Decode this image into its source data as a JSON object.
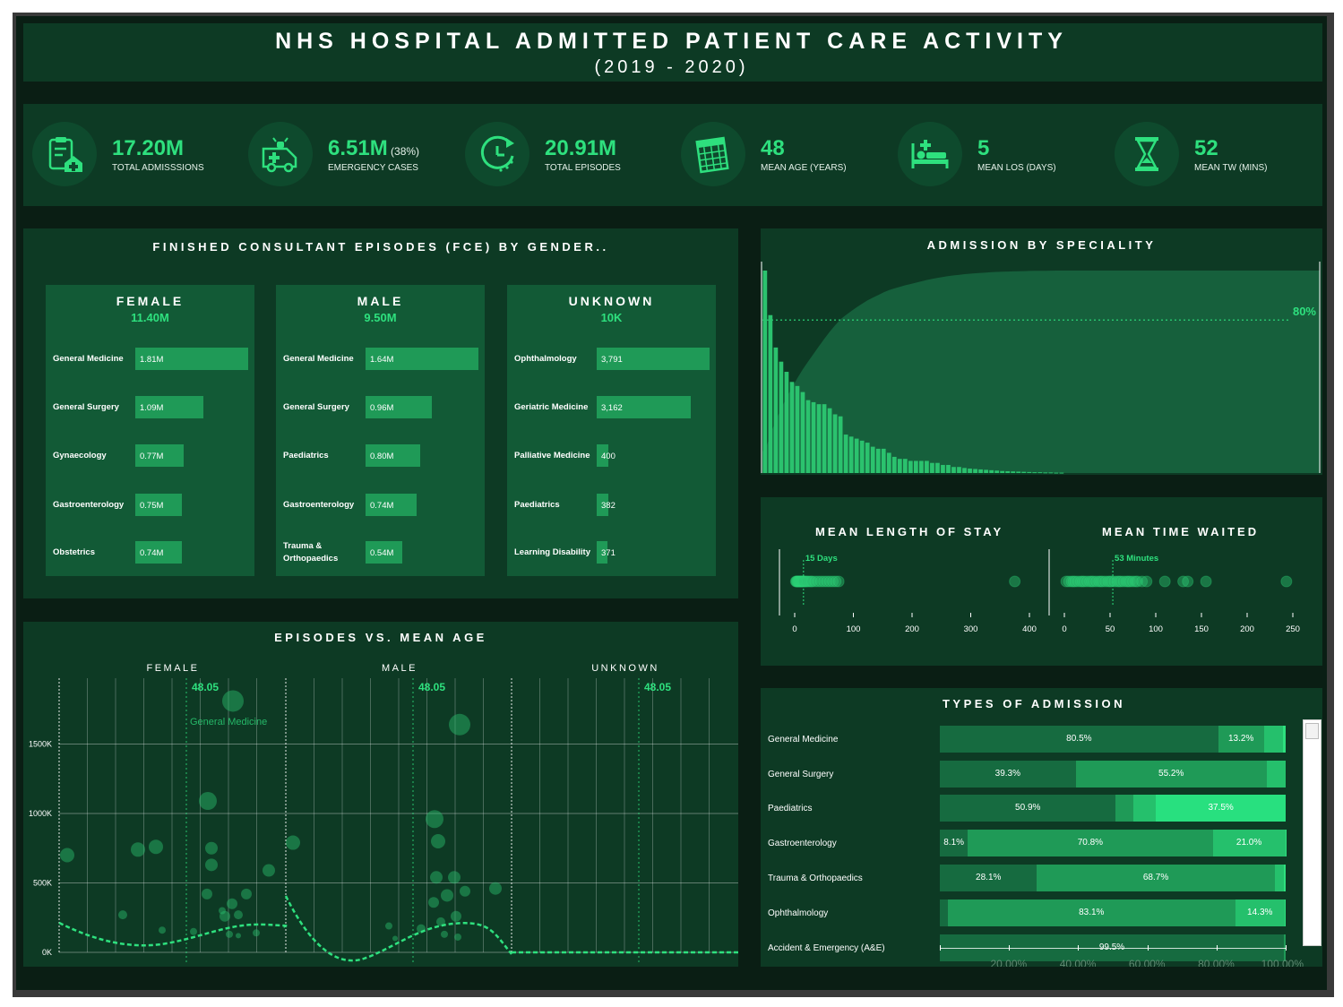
{
  "header": {
    "title": "NHS HOSPITAL ADMITTED PATIENT CARE ACTIVITY",
    "subtitle": "(2019 - 2020)"
  },
  "kpis": [
    {
      "value": "17.20M",
      "extra": "",
      "label": "TOTAL ADMISSSIONS",
      "icon": "clipboard-house-icon"
    },
    {
      "value": "6.51M",
      "extra": "(38%)",
      "label": "EMERGENCY CASES",
      "icon": "ambulance-icon"
    },
    {
      "value": "20.91M",
      "extra": "",
      "label": "TOTAL EPISODES",
      "icon": "clock-icon"
    },
    {
      "value": "48",
      "extra": "",
      "label": "MEAN AGE (YEARS)",
      "icon": "calendar-icon"
    },
    {
      "value": "5",
      "extra": "",
      "label": "MEAN LOS (DAYS)",
      "icon": "hospital-bed-icon"
    },
    {
      "value": "52",
      "extra": "",
      "label": "MEAN TW (MINS)",
      "icon": "hourglass-icon"
    }
  ],
  "fce": {
    "title": "FINISHED CONSULTANT EPISODES (FCE) BY GENDER..",
    "groups": [
      {
        "name": "FEMALE",
        "total": "11.40M",
        "rows": [
          {
            "label": "General Medicine",
            "value": 1.81,
            "text": "1.81M"
          },
          {
            "label": "General Surgery",
            "value": 1.09,
            "text": "1.09M"
          },
          {
            "label": "Gynaecology",
            "value": 0.77,
            "text": "0.77M"
          },
          {
            "label": "Gastroenterology",
            "value": 0.75,
            "text": "0.75M"
          },
          {
            "label": "Obstetrics",
            "value": 0.74,
            "text": "0.74M"
          }
        ]
      },
      {
        "name": "MALE",
        "total": "9.50M",
        "rows": [
          {
            "label": "General Medicine",
            "value": 1.64,
            "text": "1.64M"
          },
          {
            "label": "General Surgery",
            "value": 0.96,
            "text": "0.96M"
          },
          {
            "label": "Paediatrics",
            "value": 0.8,
            "text": "0.80M"
          },
          {
            "label": "Gastroenterology",
            "value": 0.74,
            "text": "0.74M"
          },
          {
            "label": "Trauma & Orthopaedics",
            "value": 0.54,
            "text": "0.54M"
          }
        ]
      },
      {
        "name": "UNKNOWN",
        "total": "10K",
        "rows": [
          {
            "label": "Ophthalmology",
            "value": 3791,
            "text": "3,791"
          },
          {
            "label": "Geriatric Medicine",
            "value": 3162,
            "text": "3,162"
          },
          {
            "label": "Palliative Medicine",
            "value": 400,
            "text": "400"
          },
          {
            "label": "Paediatrics",
            "value": 382,
            "text": "382"
          },
          {
            "label": "Learning Disability",
            "value": 371,
            "text": "371"
          }
        ]
      }
    ]
  },
  "speciality": {
    "title": "ADMISSION BY SPECIALITY",
    "ref_label": "80%",
    "bars": [
      100,
      78,
      62,
      55,
      50,
      45,
      43,
      40,
      36,
      35,
      34,
      34,
      32,
      29,
      28,
      19,
      18,
      17,
      16,
      15,
      13,
      12,
      12,
      10,
      8,
      7,
      7,
      6,
      6,
      6,
      6,
      5,
      5,
      4,
      4,
      3,
      3,
      2.5,
      2.2,
      2,
      1.8,
      1.6,
      1.4,
      1.2,
      1,
      0.9,
      0.8,
      0.7,
      0.6,
      0.5,
      0.4,
      0.4,
      0.3,
      0.3,
      0.2,
      0.2
    ]
  },
  "mean_los": {
    "title": "MEAN LENGTH OF STAY",
    "ref_label": "15 Days",
    "ticks": [
      "0",
      "100",
      "200",
      "300",
      "400"
    ],
    "points": [
      2,
      3,
      4,
      5,
      6,
      7,
      8,
      9,
      10,
      11,
      12,
      13,
      14,
      15,
      16,
      18,
      20,
      22,
      25,
      28,
      30,
      35,
      40,
      45,
      50,
      55,
      60,
      65,
      70,
      75,
      375
    ]
  },
  "mean_tw": {
    "title": "MEAN TIME WAITED",
    "ref_label": "53 Minutes",
    "ticks": [
      "0",
      "50",
      "100",
      "150",
      "200",
      "250"
    ],
    "points": [
      2,
      5,
      8,
      10,
      12,
      15,
      18,
      20,
      22,
      25,
      28,
      30,
      32,
      35,
      38,
      40,
      42,
      45,
      48,
      50,
      52,
      55,
      58,
      60,
      62,
      65,
      68,
      70,
      72,
      75,
      78,
      80,
      85,
      90,
      110,
      130,
      135,
      155,
      243
    ]
  },
  "episodes_age": {
    "title": "EPISODES VS. MEAN AGE",
    "panels": [
      "FEMALE",
      "MALE",
      "UNKNOWN"
    ],
    "ref_label": "48.05",
    "annotation": "General Medicine",
    "y_ticks": [
      "1500K",
      "1000K",
      "500K",
      "0K"
    ]
  },
  "chart_data": [
    {
      "type": "bar",
      "title": "FINISHED CONSULTANT EPISODES (FCE) BY GENDER..",
      "series": [
        {
          "name": "FEMALE",
          "categories": [
            "General Medicine",
            "General Surgery",
            "Gynaecology",
            "Gastroenterology",
            "Obstetrics"
          ],
          "values": [
            1810000,
            1090000,
            770000,
            750000,
            740000
          ]
        },
        {
          "name": "MALE",
          "categories": [
            "General Medicine",
            "General Surgery",
            "Paediatrics",
            "Gastroenterology",
            "Trauma & Orthopaedics"
          ],
          "values": [
            1640000,
            960000,
            800000,
            740000,
            540000
          ]
        },
        {
          "name": "UNKNOWN",
          "categories": [
            "Ophthalmology",
            "Geriatric Medicine",
            "Palliative Medicine",
            "Paediatrics",
            "Learning Disability"
          ],
          "values": [
            3791,
            3162,
            400,
            382,
            371
          ]
        }
      ]
    },
    {
      "type": "bar",
      "title": "TYPES OF ADMISSION",
      "x_ticks": [
        "20.00%",
        "40.00%",
        "60.00%",
        "80.00%",
        "100.00%"
      ],
      "categories": [
        "General Medicine",
        "General Surgery",
        "Paediatrics",
        "Gastroenterology",
        "Trauma & Orthopaedics",
        "Ophthalmology",
        "Accident & Emergency (A&E)"
      ],
      "rows": [
        {
          "segments": [
            80.5,
            13.2,
            5.6,
            0.7
          ],
          "labels": [
            "80.5%",
            "13.2%",
            "",
            ""
          ]
        },
        {
          "segments": [
            39.3,
            55.2,
            5.5
          ],
          "labels": [
            "39.3%",
            "55.2%",
            ""
          ]
        },
        {
          "segments": [
            50.9,
            5.1,
            6.5,
            37.5
          ],
          "labels": [
            "50.9%",
            "",
            "",
            "37.5%"
          ]
        },
        {
          "segments": [
            8.1,
            70.8,
            21.0,
            0.1
          ],
          "labels": [
            "8.1%",
            "70.8%",
            "21.0%",
            ""
          ]
        },
        {
          "segments": [
            28.1,
            68.7,
            2.6,
            0.6
          ],
          "labels": [
            "28.1%",
            "68.7%",
            "",
            ""
          ]
        },
        {
          "segments": [
            2.3,
            83.1,
            14.3,
            0.3
          ],
          "labels": [
            "",
            "83.1%",
            "14.3%",
            ""
          ]
        },
        {
          "segments": [
            99.5,
            0.5
          ],
          "labels": [
            "99.5%",
            ""
          ]
        }
      ]
    }
  ],
  "colors": {
    "panel": "#0d3a24",
    "accent": "#2ee07e",
    "bar": "#1f9a57",
    "dark_seg": "#166b40",
    "mid_seg": "#1f9a57",
    "light_seg": "#28e07f"
  }
}
